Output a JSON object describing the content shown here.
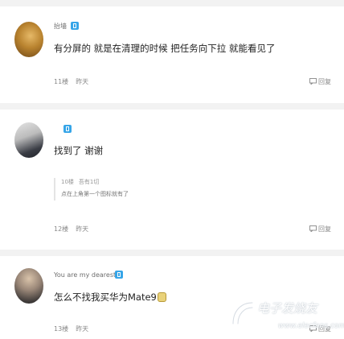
{
  "comments": [
    {
      "username": "抬墙",
      "text": "有分屏的 就是在清理的时候 把任务向下拉 就能看见了",
      "floor": "11楼",
      "time": "昨天",
      "reply_label": "回复"
    },
    {
      "username": "",
      "text": "找到了 谢谢",
      "quote": {
        "floor": "10楼",
        "author": "吾有1切",
        "text": "点在上角第一个图标就有了"
      },
      "floor": "12楼",
      "time": "昨天",
      "reply_label": "回复"
    },
    {
      "username": "You are my dearest",
      "text": "怎么不找我买华为Mate9",
      "floor": "13楼",
      "time": "昨天",
      "reply_label": "回复"
    }
  ],
  "watermark": {
    "brand": "电子发烧友",
    "url": "www.elecfans.com"
  },
  "icons": {
    "verified_badge": "verified-badge-icon",
    "reply": "reply-icon",
    "emoji": "emoji-icon"
  },
  "colors": {
    "badge": "#36a5e8",
    "divider": "#f2f2f2"
  }
}
